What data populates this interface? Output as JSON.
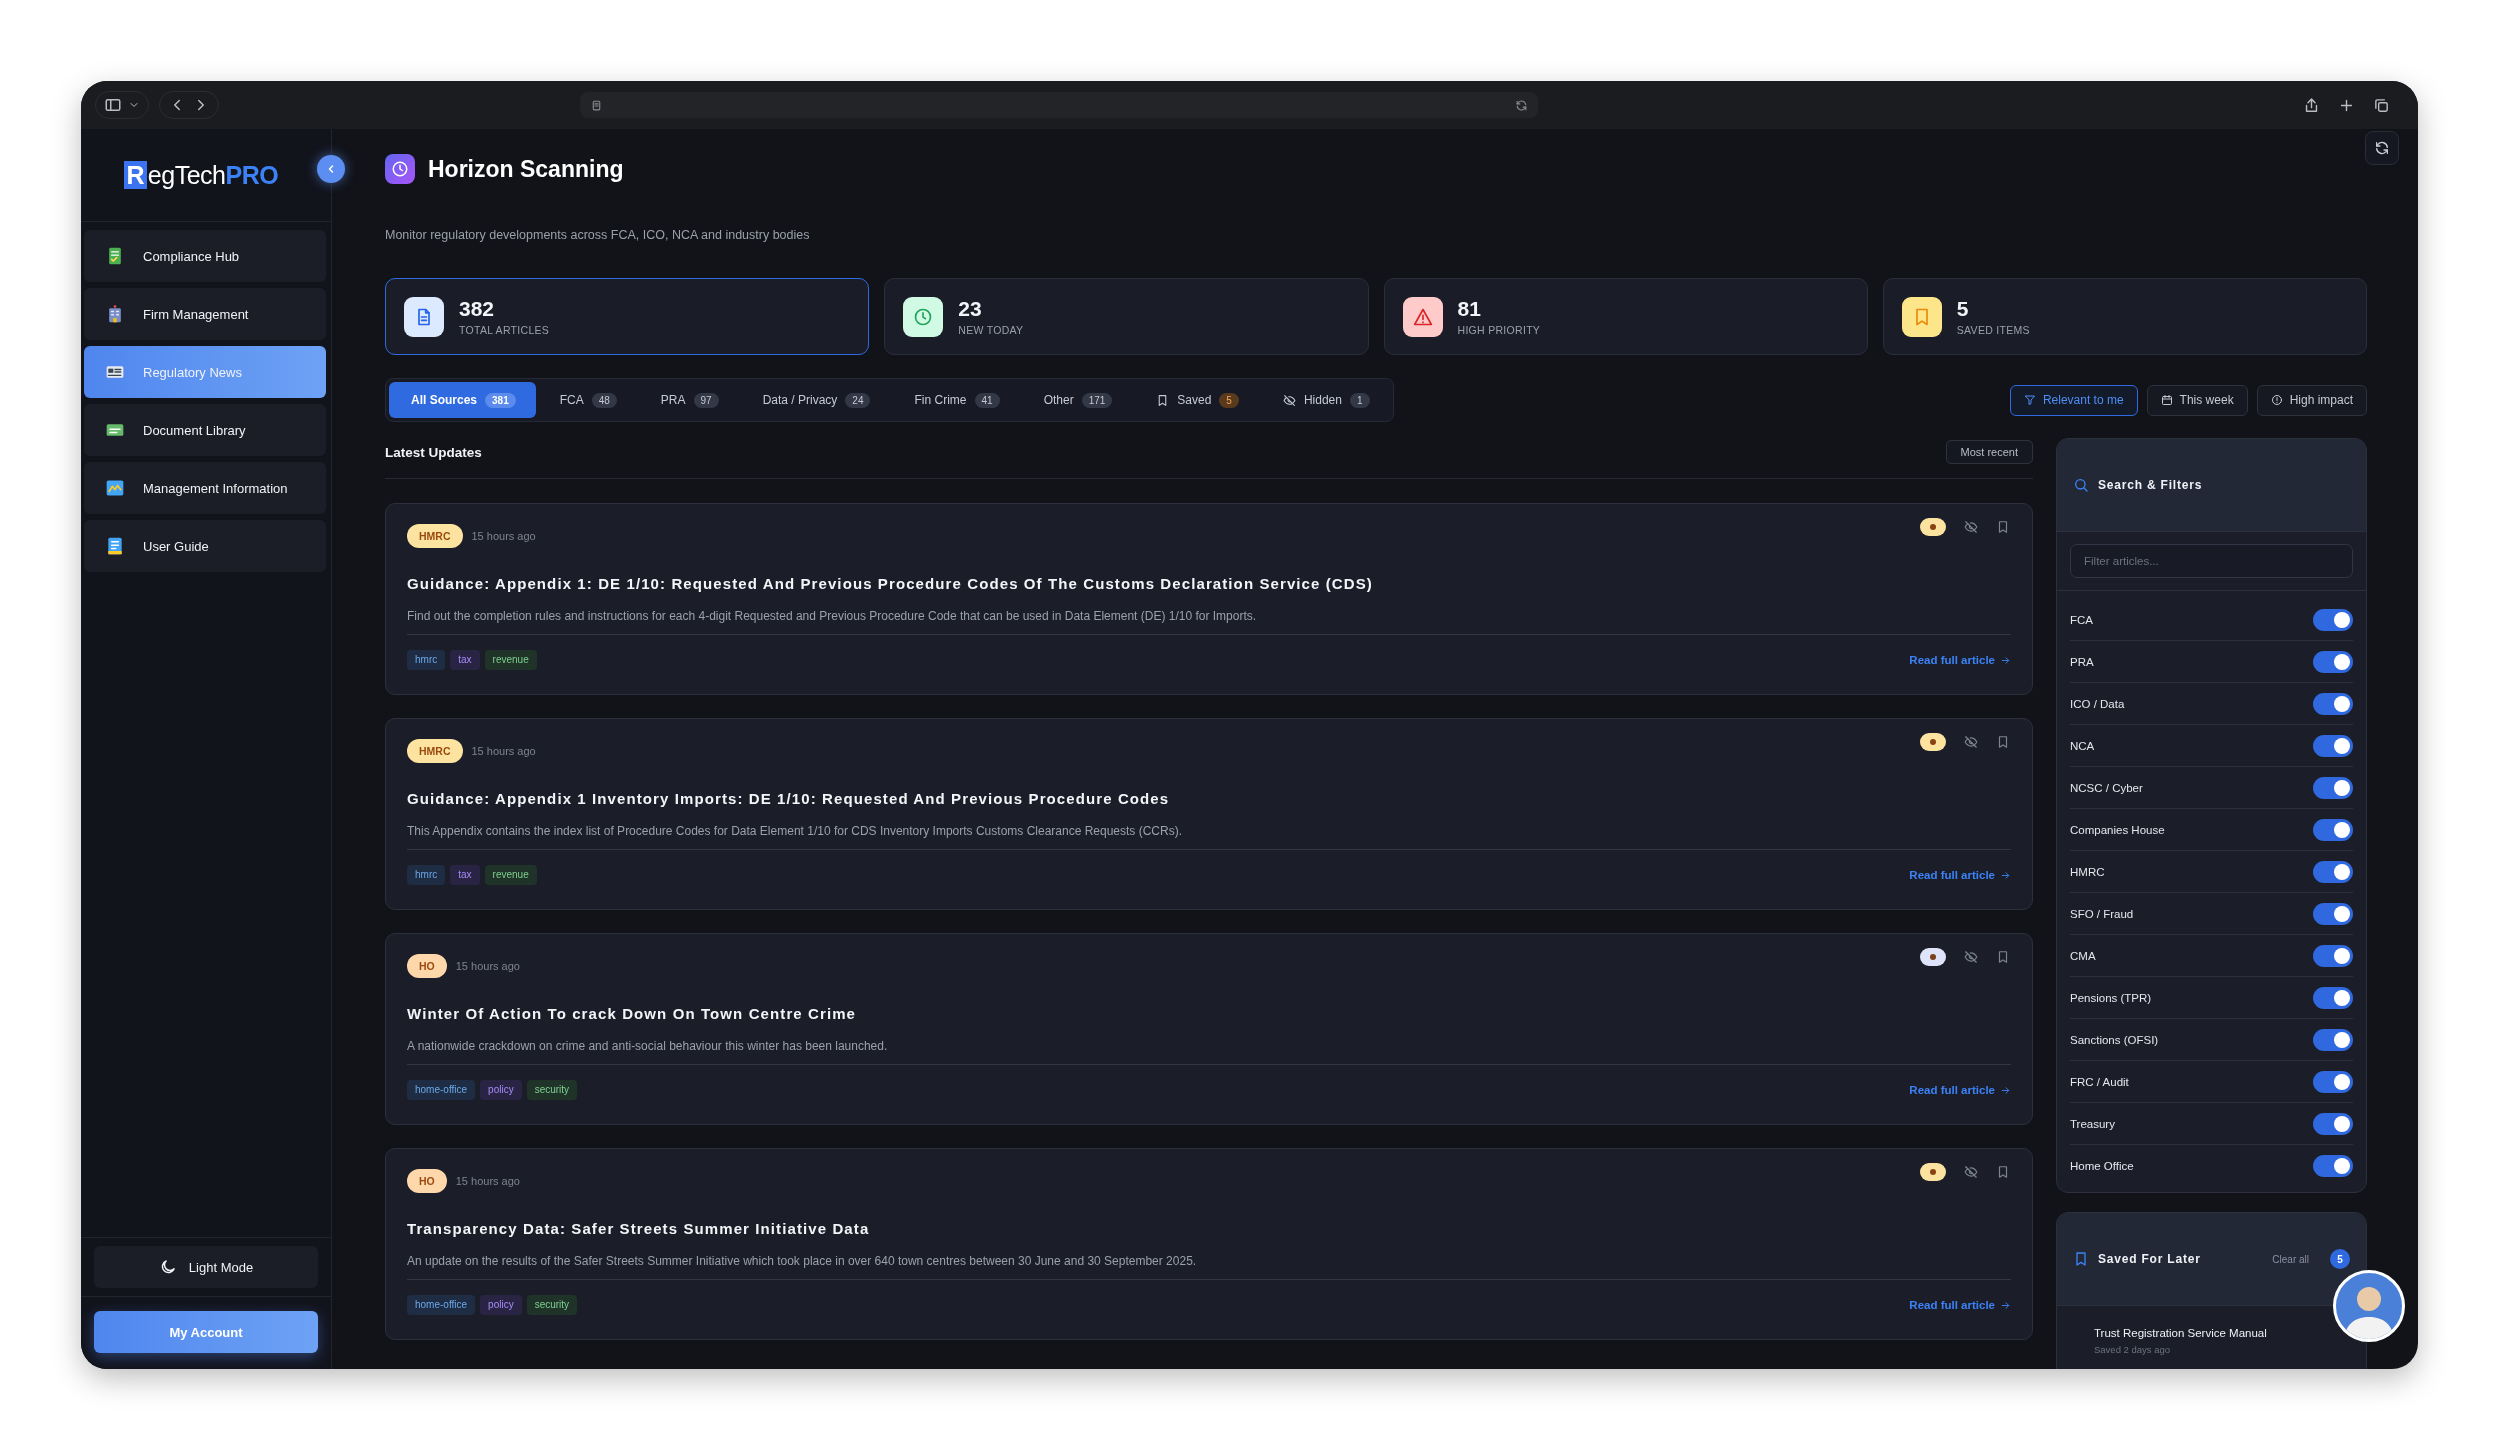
{
  "sidebar": {
    "logo": {
      "mark": "R",
      "text": "egTech",
      "accent": "PRO"
    },
    "items": [
      {
        "label": "Compliance Hub",
        "kind": "checklist",
        "selected": false
      },
      {
        "label": "Firm Management",
        "kind": "building",
        "selected": false
      },
      {
        "label": "Regulatory News",
        "kind": "news",
        "selected": true
      },
      {
        "label": "Document Library",
        "kind": "folder",
        "selected": false
      },
      {
        "label": "Management Information",
        "kind": "chart",
        "selected": false
      },
      {
        "label": "User Guide",
        "kind": "guide",
        "selected": false
      }
    ],
    "theme_button": "Light Mode",
    "account_button": "My Account"
  },
  "header": {
    "title": "Horizon Scanning",
    "subtitle": "Monitor regulatory developments across FCA, ICO, NCA and industry bodies"
  },
  "stats": [
    {
      "value": "382",
      "label": "TOTAL ARTICLES",
      "kind": "articles",
      "selected": true
    },
    {
      "value": "23",
      "label": "NEW TODAY",
      "kind": "new",
      "selected": false
    },
    {
      "value": "81",
      "label": "HIGH PRIORITY",
      "kind": "priority",
      "selected": false
    },
    {
      "value": "5",
      "label": "SAVED ITEMS",
      "kind": "saved",
      "selected": false
    }
  ],
  "source_tabs": [
    {
      "label": "All Sources",
      "count": "381",
      "kind": "source",
      "selected": true
    },
    {
      "label": "FCA",
      "count": "48",
      "kind": "source",
      "selected": false
    },
    {
      "label": "PRA",
      "count": "97",
      "kind": "source",
      "selected": false
    },
    {
      "label": "Data / Privacy",
      "count": "24",
      "kind": "source",
      "selected": false
    },
    {
      "label": "Fin Crime",
      "count": "41",
      "kind": "source",
      "selected": false
    },
    {
      "label": "Other",
      "count": "171",
      "kind": "source",
      "selected": false
    },
    {
      "label": "Saved",
      "count": "5",
      "kind": "saved",
      "selected": false
    },
    {
      "label": "Hidden",
      "count": "1",
      "kind": "hidden",
      "selected": false
    }
  ],
  "quick_filters": [
    {
      "label": "Relevant to me",
      "kind": "filter",
      "selected": true
    },
    {
      "label": "This week",
      "kind": "calendar",
      "selected": false
    },
    {
      "label": "High impact",
      "kind": "impact",
      "selected": false
    }
  ],
  "feed": {
    "title": "Latest Updates",
    "sort_button": "Most recent",
    "articles": [
      {
        "source": {
          "label": "HMRC",
          "color": "#fde3a0"
        },
        "time": "15 hours ago",
        "marker": {
          "color": "#fde3a0"
        },
        "title": "Guidance: Appendix 1: DE 1/10: Requested And Previous Procedure Codes Of The Customs Declaration Service (CDS)",
        "description": "Find out the completion rules and instructions for each 4-digit Requested and Previous Procedure Code that can be used in Data Element (DE) 1/10 for Imports.",
        "tags": [
          {
            "label": "hmrc",
            "color": "#1f2d44"
          },
          {
            "label": "tax",
            "color": "#2a2444"
          },
          {
            "label": "revenue",
            "color": "#1f3329"
          }
        ],
        "link": "Read full article"
      },
      {
        "source": {
          "label": "HMRC",
          "color": "#fde3a0"
        },
        "time": "15 hours ago",
        "marker": {
          "color": "#fde3a0"
        },
        "title": "Guidance: Appendix 1 Inventory Imports: DE 1/10: Requested And Previous Procedure Codes",
        "description": "This Appendix contains the index list of Procedure Codes for Data Element 1/10 for CDS Inventory Imports Customs Clearance Requests (CCRs).",
        "tags": [
          {
            "label": "hmrc",
            "color": "#1f2d44"
          },
          {
            "label": "tax",
            "color": "#2a2444"
          },
          {
            "label": "revenue",
            "color": "#1f3329"
          }
        ],
        "link": "Read full article"
      },
      {
        "source": {
          "label": "HO",
          "color": "#fed7aa"
        },
        "time": "15 hours ago",
        "marker": {
          "color": "#e0e4fb"
        },
        "title": "Winter Of Action To crack Down On Town Centre Crime",
        "description": "A nationwide crackdown on crime and anti-social behaviour  this winter has been launched.",
        "tags": [
          {
            "label": "home-office",
            "color": "#1f2d44"
          },
          {
            "label": "policy",
            "color": "#2a2444"
          },
          {
            "label": "security",
            "color": "#1f3329"
          }
        ],
        "link": "Read full article"
      },
      {
        "source": {
          "label": "HO",
          "color": "#fed7aa"
        },
        "time": "15 hours ago",
        "marker": {
          "color": "#fde3a0"
        },
        "title": "Transparency Data: Safer Streets Summer Initiative Data",
        "description": "An update on the results of the Safer Streets Summer Initiative which took place in over 640 town centres between 30 June and 30 September 2025.",
        "tags": [
          {
            "label": "home-office",
            "color": "#1f2d44"
          },
          {
            "label": "policy",
            "color": "#2a2444"
          },
          {
            "label": "security",
            "color": "#1f3329"
          }
        ],
        "link": "Read full article"
      }
    ]
  },
  "filters": {
    "title": "Search & Filters",
    "placeholder": "Filter articles...",
    "toggles": [
      {
        "label": "FCA",
        "on": true
      },
      {
        "label": "PRA",
        "on": true
      },
      {
        "label": "ICO / Data",
        "on": true
      },
      {
        "label": "NCA",
        "on": true
      },
      {
        "label": "NCSC / Cyber",
        "on": true
      },
      {
        "label": "Companies House",
        "on": true
      },
      {
        "label": "HMRC",
        "on": true
      },
      {
        "label": "SFO / Fraud",
        "on": true
      },
      {
        "label": "CMA",
        "on": true
      },
      {
        "label": "Pensions (TPR)",
        "on": true
      },
      {
        "label": "Sanctions (OFSI)",
        "on": true
      },
      {
        "label": "FRC / Audit",
        "on": true
      },
      {
        "label": "Treasury",
        "on": true
      },
      {
        "label": "Home Office",
        "on": true
      }
    ]
  },
  "saved": {
    "title": "Saved For Later",
    "clear_button": "Clear all",
    "count": "5",
    "items": [
      {
        "title": "Trust Registration Service Manual",
        "meta": "Saved 2 days ago"
      }
    ]
  }
}
